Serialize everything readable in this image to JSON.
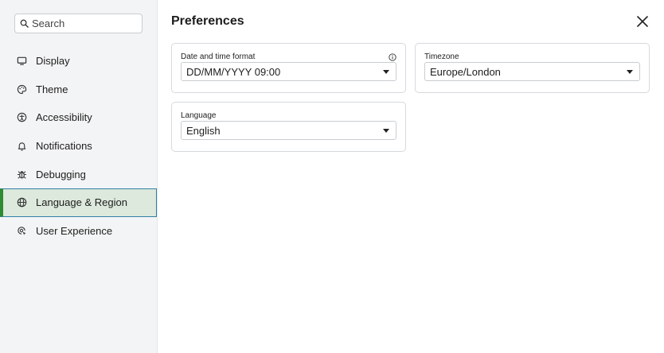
{
  "search": {
    "placeholder": "Search"
  },
  "sidebar": {
    "items": [
      {
        "label": "Display",
        "icon": "monitor-icon"
      },
      {
        "label": "Theme",
        "icon": "palette-icon"
      },
      {
        "label": "Accessibility",
        "icon": "accessibility-icon"
      },
      {
        "label": "Notifications",
        "icon": "bell-icon"
      },
      {
        "label": "Debugging",
        "icon": "bug-icon"
      },
      {
        "label": "Language & Region",
        "icon": "globe-icon",
        "active": true
      },
      {
        "label": "User Experience",
        "icon": "ux-icon"
      }
    ]
  },
  "header": {
    "title": "Preferences"
  },
  "settings": {
    "date_format": {
      "label": "Date and time format",
      "value": "DD/MM/YYYY 09:00"
    },
    "timezone": {
      "label": "Timezone",
      "value": "Europe/London"
    },
    "language": {
      "label": "Language",
      "value": "English"
    }
  },
  "colors": {
    "accent_green": "#2e8a33",
    "active_bg": "#dde9dc",
    "focus_border": "#2f7fa7"
  }
}
